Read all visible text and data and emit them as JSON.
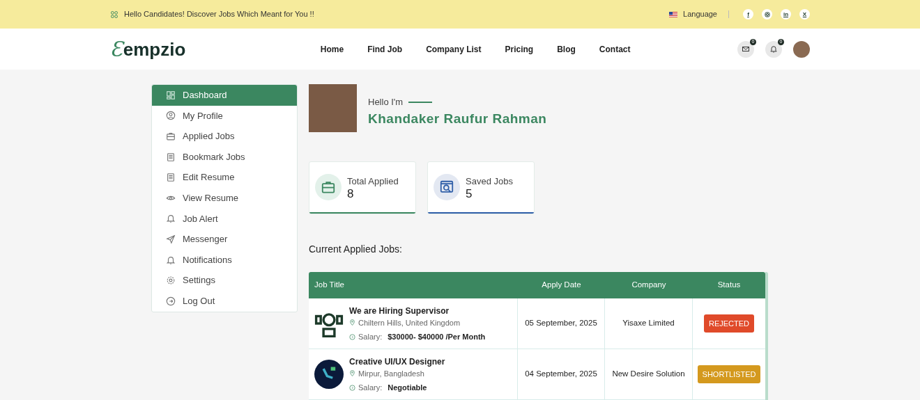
{
  "topbar": {
    "message": "Hello Candidates! Discover Jobs Which Meant for You !!",
    "language": "Language",
    "social": [
      {
        "kind": "facebook",
        "label": "f"
      },
      {
        "kind": "instagram"
      },
      {
        "kind": "linkedin",
        "label": "in"
      },
      {
        "kind": "x",
        "label": "X"
      }
    ]
  },
  "navbar": {
    "logo": {
      "mark": "Ɛ",
      "text": "empzio"
    },
    "links": [
      "Home",
      "Find Job",
      "Company List",
      "Pricing",
      "Blog",
      "Contact"
    ],
    "message_count": "0",
    "notification_count": "0"
  },
  "sidebar": {
    "items": [
      {
        "label": "Dashboard",
        "kind": "grid",
        "selected": true
      },
      {
        "label": "My Profile",
        "kind": "user",
        "selected": false
      },
      {
        "label": "Applied Jobs",
        "kind": "briefcase",
        "selected": false
      },
      {
        "label": "Bookmark Jobs",
        "kind": "doc",
        "selected": false
      },
      {
        "label": "Edit Resume",
        "kind": "doc",
        "selected": false
      },
      {
        "label": "View Resume",
        "kind": "eye",
        "selected": false
      },
      {
        "label": "Job Alert",
        "kind": "bell",
        "selected": false
      },
      {
        "label": "Messenger",
        "kind": "plane",
        "selected": false
      },
      {
        "label": "Notifications",
        "kind": "bell",
        "selected": false
      },
      {
        "label": "Settings",
        "kind": "gear",
        "selected": false
      },
      {
        "label": "Log Out",
        "kind": "logout",
        "selected": false
      }
    ]
  },
  "profile": {
    "greeting": "Hello I'm",
    "name": "Khandaker Raufur Rahman"
  },
  "stats": [
    {
      "label": "Total Applied",
      "value": "8",
      "kind": "briefcase",
      "color": "#3b8760"
    },
    {
      "label": "Saved Jobs",
      "value": "5",
      "kind": "job",
      "color": "#2f5ea8"
    }
  ],
  "section_title": "Current Applied Jobs:",
  "table": {
    "columns": [
      "Job Title",
      "Apply Date",
      "Company",
      "Status"
    ],
    "rows": [
      {
        "title": "We are Hiring Supervisor",
        "location": "Chiltern Hills, United Kingdom",
        "salary_label": "Salary:",
        "salary": "$30000- $40000 /Per Month",
        "kind": "person",
        "date": "05 September, 2025",
        "company": "Yisaxe Limited",
        "status": "REJECTED",
        "color": "#e04a2a"
      },
      {
        "title": "Creative UI/UX Designer",
        "location": "Mirpur, Bangladesh",
        "salary_label": "Salary:",
        "salary": "Negotiable",
        "kind": "tech",
        "date": "04 September, 2025",
        "company": "New Desire Solution",
        "status": "SHORTLISTED",
        "color": "#d4991e"
      }
    ]
  }
}
